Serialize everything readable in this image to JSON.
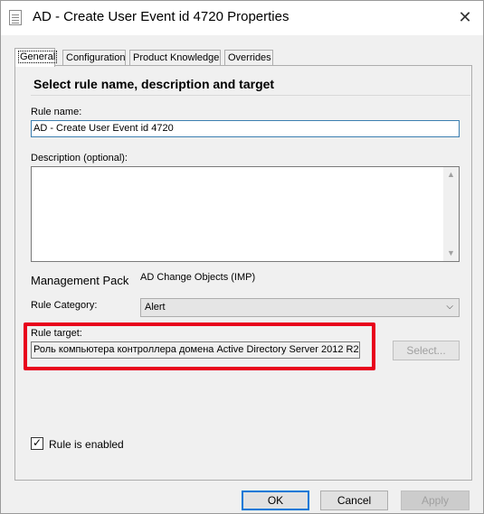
{
  "window": {
    "title": "AD - Create User Event id 4720 Properties",
    "close_icon": "close-icon"
  },
  "tabs": [
    {
      "label": "General",
      "active": true
    },
    {
      "label": "Configuration",
      "active": false
    },
    {
      "label": "Product Knowledge",
      "active": false
    },
    {
      "label": "Overrides",
      "active": false
    }
  ],
  "section": {
    "header": "Select rule name, description and target"
  },
  "rule_name": {
    "label": "Rule name:",
    "value": "AD - Create User Event id 4720"
  },
  "description": {
    "label": "Description (optional):",
    "value": ""
  },
  "management_pack": {
    "label": "Management Pack",
    "value": "AD Change Objects (IMP)"
  },
  "rule_category": {
    "label": "Rule Category:",
    "selected": "Alert"
  },
  "rule_target": {
    "label": "Rule target:",
    "value": "Роль компьютера контроллера домена Active Directory Server 2012 R2",
    "select_button": "Select..."
  },
  "enabled": {
    "label": "Rule is enabled",
    "checked": true
  },
  "footer": {
    "ok": "OK",
    "cancel": "Cancel",
    "apply": "Apply"
  },
  "colors": {
    "highlight": "#e8001c",
    "focus_border": "#3c7fb1"
  }
}
